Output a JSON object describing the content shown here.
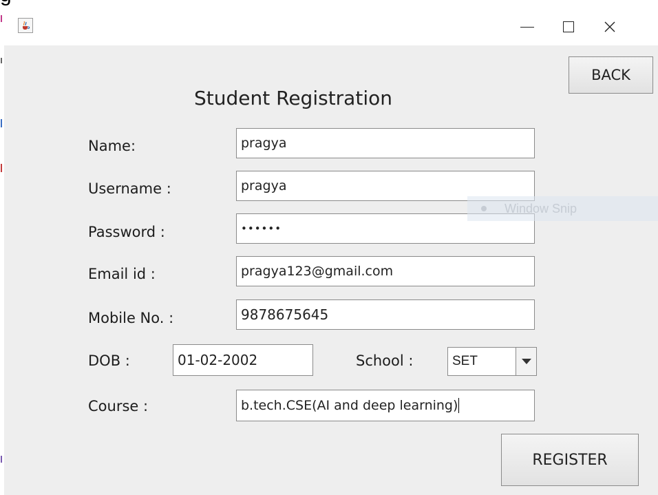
{
  "window": {
    "title": "",
    "controls": {
      "minimize": "—",
      "maximize": "",
      "close": "✕"
    }
  },
  "form": {
    "title": "Student Registration",
    "back_label": "BACK",
    "register_label": "REGISTER",
    "name_label": "Name:",
    "name_value": "pragya",
    "username_label": "Username :",
    "username_value": "pragya",
    "password_label": "Password :",
    "password_value": "••••••",
    "email_label": "Email id :",
    "email_value": "pragya123@gmail.com",
    "mobile_label": "Mobile No. :",
    "mobile_value": "9878675645",
    "dob_label": "DOB :",
    "dob_value": "01-02-2002",
    "school_label": "School :",
    "school_value": "SET",
    "course_label": "Course :",
    "course_value": "b.tech.CSE(AI and deep learning)"
  },
  "overlay": {
    "snip_text": "Window Snip"
  },
  "colors": {
    "window_bg": "#eeeeee",
    "titlebar_bg": "#ffffff",
    "field_border": "#8a8a8a"
  },
  "icons": {
    "app": "java-coffee-icon",
    "minimize": "minimize-icon",
    "maximize": "maximize-icon",
    "close": "close-icon"
  }
}
